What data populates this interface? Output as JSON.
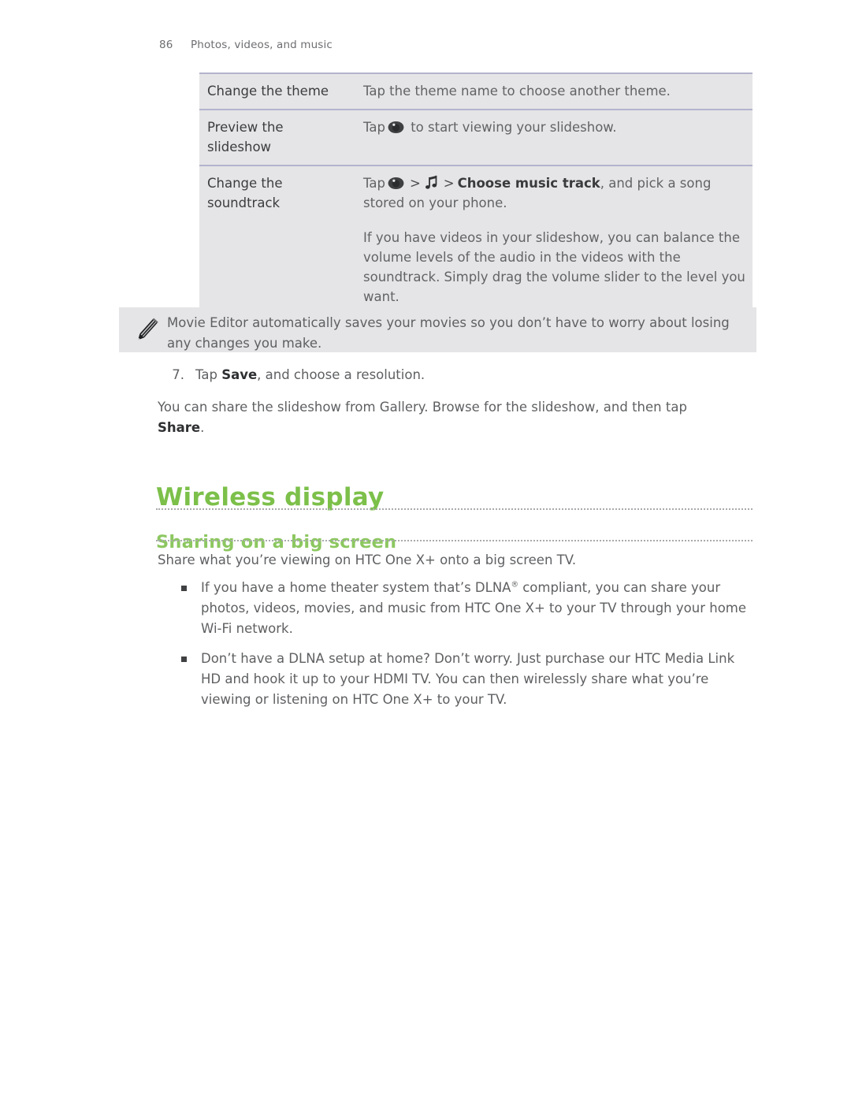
{
  "header": {
    "page_number": "86",
    "section_title": "Photos, videos, and music"
  },
  "spec_table": {
    "rows": [
      {
        "label": "Change the theme",
        "desc_prefix": "Tap the theme name to choose another theme.",
        "icons": []
      },
      {
        "label": "Preview the slideshow",
        "desc_prefix": "Tap",
        "desc_suffix": "to start viewing your slideshow.",
        "icons": [
          "eye-icon"
        ]
      },
      {
        "label": "Change the soundtrack",
        "desc_prefix": "Tap",
        "chevron": ">",
        "bold_text": "Choose music track",
        "desc_suffix": ", and pick a song stored on your phone.",
        "icons": [
          "eye-icon",
          "music-note-icon"
        ]
      }
    ],
    "extra_paragraph": "If you have videos in your slideshow, you can balance the volume levels of the audio in the videos with the soundtrack. Simply drag the volume slider to the level you want."
  },
  "note": {
    "icon": "pencil-icon",
    "text": "Movie Editor automatically saves your movies so you don’t have to worry about losing any changes you make."
  },
  "step": {
    "number": "7.",
    "text_before": "Tap ",
    "bold": "Save",
    "text_after": ", and choose a resolution."
  },
  "paragraph": {
    "text_before": "You can share the slideshow from Gallery. Browse for the slideshow, and then tap ",
    "bold": "Share",
    "text_after": "."
  },
  "headings": {
    "h1": "Wireless display",
    "h2": "Sharing on a big screen",
    "h1_color": "#7cc04a",
    "h2_color": "#8cc760"
  },
  "intro": "Share what you’re viewing on HTC One X+ onto a big screen TV.",
  "bullets": [
    {
      "text_before": "If you have a home theater system that’s DLNA",
      "superscript": "®",
      "text_after": " compliant, you can share your photos, videos, movies, and music from HTC One X+ to your TV through your home Wi-Fi network."
    },
    {
      "text_before": "Don’t have a DLNA setup at home? Don’t worry. Just purchase our HTC Media Link HD and hook it up to your HDMI TV. You can then wirelessly share what you’re viewing or listening on HTC One X+ to your TV.",
      "superscript": "",
      "text_after": ""
    }
  ]
}
